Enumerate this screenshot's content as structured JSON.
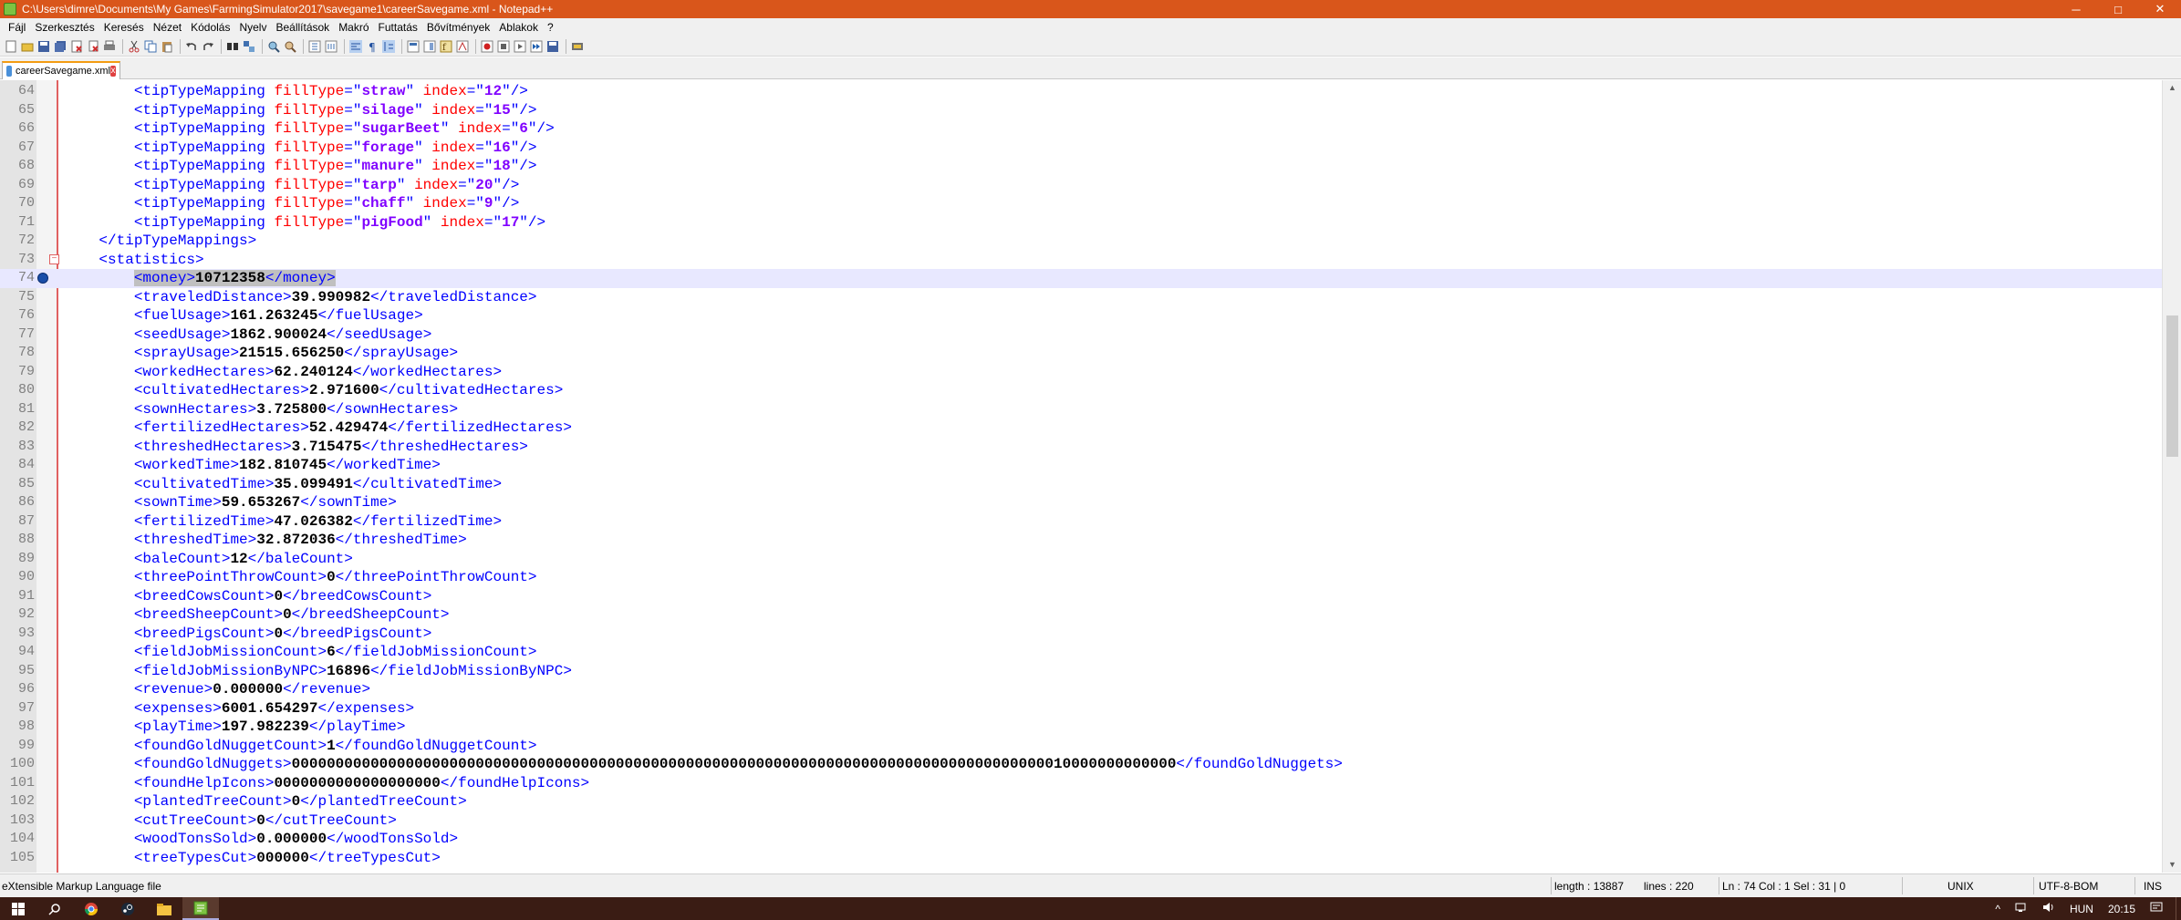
{
  "window": {
    "title": "C:\\Users\\dimre\\Documents\\My Games\\FarmingSimulator2017\\savegame1\\careerSavegame.xml - Notepad++",
    "minimize": "─",
    "maximize": "□",
    "close": "✕"
  },
  "menu": [
    "Fájl",
    "Szerkesztés",
    "Keresés",
    "Nézet",
    "Kódolás",
    "Nyelv",
    "Beállítások",
    "Makró",
    "Futtatás",
    "Bővítmények",
    "Ablakok",
    "?"
  ],
  "tab": {
    "label": "careerSavegame.xml",
    "close": "x"
  },
  "editor": {
    "current_line": 74,
    "lines": [
      {
        "n": 64,
        "indent": "        ",
        "kind": "tip",
        "fill": "straw",
        "index": "12"
      },
      {
        "n": 65,
        "indent": "        ",
        "kind": "tip",
        "fill": "silage",
        "index": "15"
      },
      {
        "n": 66,
        "indent": "        ",
        "kind": "tip",
        "fill": "sugarBeet",
        "index": "6"
      },
      {
        "n": 67,
        "indent": "        ",
        "kind": "tip",
        "fill": "forage",
        "index": "16"
      },
      {
        "n": 68,
        "indent": "        ",
        "kind": "tip",
        "fill": "manure",
        "index": "18"
      },
      {
        "n": 69,
        "indent": "        ",
        "kind": "tip",
        "fill": "tarp",
        "index": "20"
      },
      {
        "n": 70,
        "indent": "        ",
        "kind": "tip",
        "fill": "chaff",
        "index": "9"
      },
      {
        "n": 71,
        "indent": "        ",
        "kind": "tip",
        "fill": "pigFood",
        "index": "17"
      },
      {
        "n": 72,
        "indent": "    ",
        "kind": "close",
        "tag": "tipTypeMappings"
      },
      {
        "n": 73,
        "indent": "    ",
        "kind": "open",
        "tag": "statistics"
      },
      {
        "n": 74,
        "indent": "        ",
        "kind": "elem",
        "tag": "money",
        "value": "10712358"
      },
      {
        "n": 75,
        "indent": "        ",
        "kind": "elem",
        "tag": "traveledDistance",
        "value": "39.990982"
      },
      {
        "n": 76,
        "indent": "        ",
        "kind": "elem",
        "tag": "fuelUsage",
        "value": "161.263245"
      },
      {
        "n": 77,
        "indent": "        ",
        "kind": "elem",
        "tag": "seedUsage",
        "value": "1862.900024"
      },
      {
        "n": 78,
        "indent": "        ",
        "kind": "elem",
        "tag": "sprayUsage",
        "value": "21515.656250"
      },
      {
        "n": 79,
        "indent": "        ",
        "kind": "elem",
        "tag": "workedHectares",
        "value": "62.240124"
      },
      {
        "n": 80,
        "indent": "        ",
        "kind": "elem",
        "tag": "cultivatedHectares",
        "value": "2.971600"
      },
      {
        "n": 81,
        "indent": "        ",
        "kind": "elem",
        "tag": "sownHectares",
        "value": "3.725800"
      },
      {
        "n": 82,
        "indent": "        ",
        "kind": "elem",
        "tag": "fertilizedHectares",
        "value": "52.429474"
      },
      {
        "n": 83,
        "indent": "        ",
        "kind": "elem",
        "tag": "threshedHectares",
        "value": "3.715475"
      },
      {
        "n": 84,
        "indent": "        ",
        "kind": "elem",
        "tag": "workedTime",
        "value": "182.810745"
      },
      {
        "n": 85,
        "indent": "        ",
        "kind": "elem",
        "tag": "cultivatedTime",
        "value": "35.099491"
      },
      {
        "n": 86,
        "indent": "        ",
        "kind": "elem",
        "tag": "sownTime",
        "value": "59.653267"
      },
      {
        "n": 87,
        "indent": "        ",
        "kind": "elem",
        "tag": "fertilizedTime",
        "value": "47.026382"
      },
      {
        "n": 88,
        "indent": "        ",
        "kind": "elem",
        "tag": "threshedTime",
        "value": "32.872036"
      },
      {
        "n": 89,
        "indent": "        ",
        "kind": "elem",
        "tag": "baleCount",
        "value": "12"
      },
      {
        "n": 90,
        "indent": "        ",
        "kind": "elem",
        "tag": "threePointThrowCount",
        "value": "0"
      },
      {
        "n": 91,
        "indent": "        ",
        "kind": "elem",
        "tag": "breedCowsCount",
        "value": "0"
      },
      {
        "n": 92,
        "indent": "        ",
        "kind": "elem",
        "tag": "breedSheepCount",
        "value": "0"
      },
      {
        "n": 93,
        "indent": "        ",
        "kind": "elem",
        "tag": "breedPigsCount",
        "value": "0"
      },
      {
        "n": 94,
        "indent": "        ",
        "kind": "elem",
        "tag": "fieldJobMissionCount",
        "value": "6"
      },
      {
        "n": 95,
        "indent": "        ",
        "kind": "elem",
        "tag": "fieldJobMissionByNPC",
        "value": "16896"
      },
      {
        "n": 96,
        "indent": "        ",
        "kind": "elem",
        "tag": "revenue",
        "value": "0.000000"
      },
      {
        "n": 97,
        "indent": "        ",
        "kind": "elem",
        "tag": "expenses",
        "value": "6001.654297"
      },
      {
        "n": 98,
        "indent": "        ",
        "kind": "elem",
        "tag": "playTime",
        "value": "197.982239"
      },
      {
        "n": 99,
        "indent": "        ",
        "kind": "elem",
        "tag": "foundGoldNuggetCount",
        "value": "1"
      },
      {
        "n": 100,
        "indent": "        ",
        "kind": "elem",
        "tag": "foundGoldNuggets",
        "value": "00000000000000000000000000000000000000000000000000000000000000000000000000000000000000010000000000000"
      },
      {
        "n": 101,
        "indent": "        ",
        "kind": "elem",
        "tag": "foundHelpIcons",
        "value": "0000000000000000000"
      },
      {
        "n": 102,
        "indent": "        ",
        "kind": "elem",
        "tag": "plantedTreeCount",
        "value": "0"
      },
      {
        "n": 103,
        "indent": "        ",
        "kind": "elem",
        "tag": "cutTreeCount",
        "value": "0"
      },
      {
        "n": 104,
        "indent": "        ",
        "kind": "elem",
        "tag": "woodTonsSold",
        "value": "0.000000"
      },
      {
        "n": 105,
        "indent": "        ",
        "kind": "elem",
        "tag": "treeTypesCut",
        "value": "000000"
      }
    ]
  },
  "status": {
    "filetype": "eXtensible Markup Language file",
    "length": "length : 13887",
    "lines": "lines : 220",
    "position": "Ln : 74    Col : 1    Sel : 31 | 0",
    "eol": "UNIX",
    "encoding": "UTF-8-BOM",
    "mode": "INS"
  },
  "taskbar": {
    "language": "HUN",
    "time": "20:15"
  }
}
